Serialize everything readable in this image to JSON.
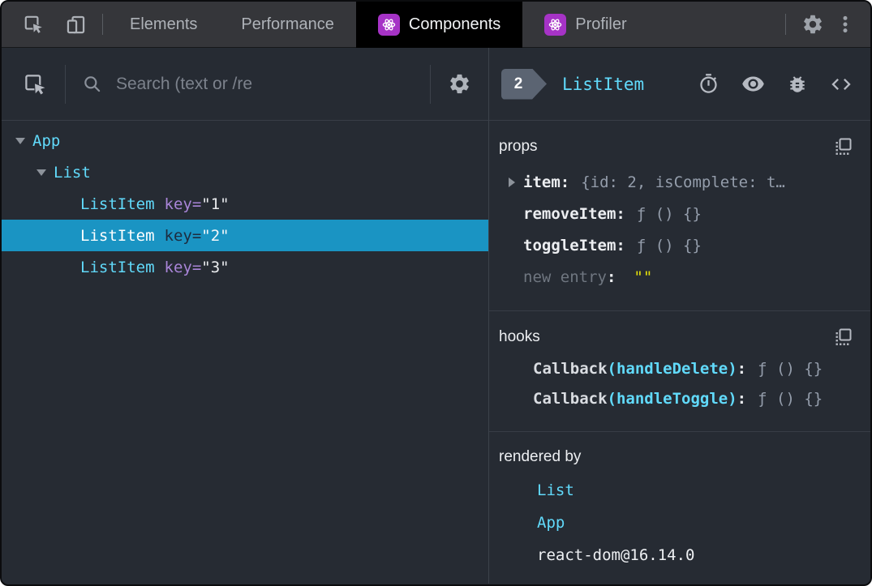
{
  "topbar": {
    "tabs": [
      {
        "label": "Elements"
      },
      {
        "label": "Performance"
      },
      {
        "label": "Components"
      },
      {
        "label": "Profiler"
      }
    ]
  },
  "search": {
    "placeholder": "Search (text or /re"
  },
  "tree": {
    "rows": [
      {
        "name": "App"
      },
      {
        "name": "List"
      },
      {
        "name": "ListItem",
        "attr": "key=",
        "value": "\"1\""
      },
      {
        "name": "ListItem",
        "attr": "key=",
        "value": "\"2\""
      },
      {
        "name": "ListItem",
        "attr": "key=",
        "value": "\"3\""
      }
    ]
  },
  "inspector": {
    "badge": "2",
    "title": "ListItem",
    "props": {
      "heading": "props",
      "rows": [
        {
          "key": "item",
          "value": "{id: 2, isComplete: t…"
        },
        {
          "key": "removeItem",
          "value": "ƒ () {}"
        },
        {
          "key": "toggleItem",
          "value": "ƒ () {}"
        },
        {
          "key": "new entry",
          "value": "\"\""
        }
      ]
    },
    "hooks": {
      "heading": "hooks",
      "rows": [
        {
          "name": "Callback",
          "arg": "(handleDelete)",
          "value": "ƒ () {}"
        },
        {
          "name": "Callback",
          "arg": "(handleToggle)",
          "value": "ƒ () {}"
        }
      ]
    },
    "rendered_by": {
      "heading": "rendered by",
      "items": [
        {
          "label": "List"
        },
        {
          "label": "App"
        },
        {
          "label": "react-dom@16.14.0"
        }
      ]
    }
  },
  "punct": {
    "colon": ":"
  },
  "colors": {
    "accent_cyan": "#61dafb",
    "attr_purple": "#a985d8",
    "selected_row": "#1a94c3",
    "string_yellow": "#e5e10a",
    "react_icon_purple": "#a633c6",
    "active_tab_bg": "#000000",
    "toolbar_bg": "#35363a",
    "panel_bg": "#262b33"
  }
}
